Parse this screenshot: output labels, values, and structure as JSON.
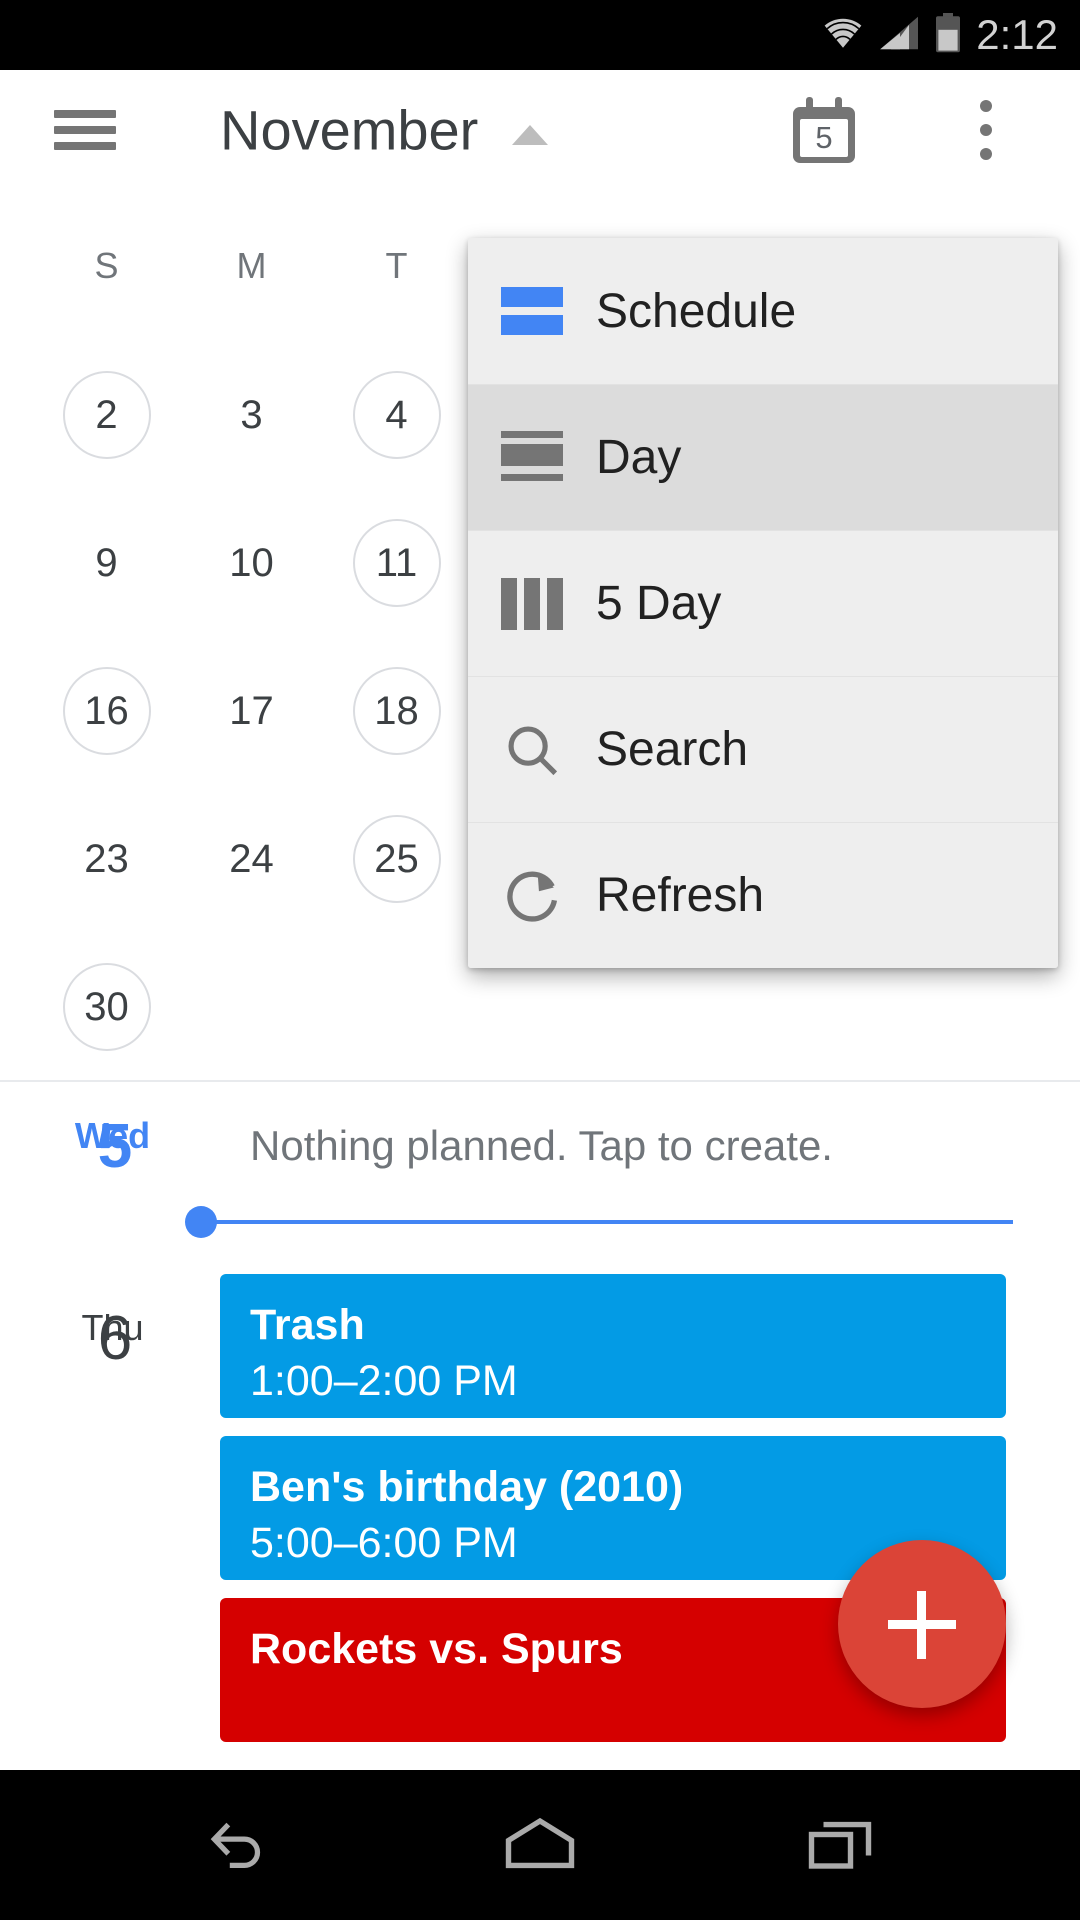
{
  "status_bar": {
    "time": "2:12",
    "icons": [
      "wifi-icon",
      "cellular-signal-icon",
      "battery-icon"
    ]
  },
  "app_bar": {
    "menu_icon": "hamburger-menu-icon",
    "title": "November",
    "caret_icon": "chevron-up-icon",
    "today_icon": "calendar-today-icon",
    "today_number": "5",
    "overflow_icon": "overflow-menu-icon"
  },
  "view_menu": {
    "items": [
      {
        "label": "Schedule",
        "icon": "schedule-view-icon",
        "selected": false,
        "active": true
      },
      {
        "label": "Day",
        "icon": "day-view-icon",
        "selected": true,
        "active": false
      },
      {
        "label": "5 Day",
        "icon": "five-day-view-icon",
        "selected": false,
        "active": false
      },
      {
        "label": "Search",
        "icon": "search-icon",
        "selected": false,
        "active": false
      },
      {
        "label": "Refresh",
        "icon": "refresh-icon",
        "selected": false,
        "active": false
      }
    ]
  },
  "mini_month": {
    "day_headers": [
      "S",
      "M",
      "T"
    ],
    "weeks": [
      [
        {
          "num": "2",
          "ring": true
        },
        {
          "num": "3",
          "ring": false
        },
        {
          "num": "4",
          "ring": true
        }
      ],
      [
        {
          "num": "9",
          "ring": false
        },
        {
          "num": "10",
          "ring": false
        },
        {
          "num": "11",
          "ring": true
        }
      ],
      [
        {
          "num": "16",
          "ring": true
        },
        {
          "num": "17",
          "ring": false
        },
        {
          "num": "18",
          "ring": true
        }
      ],
      [
        {
          "num": "23",
          "ring": false
        },
        {
          "num": "24",
          "ring": false
        },
        {
          "num": "25",
          "ring": true
        }
      ],
      [
        {
          "num": "30",
          "ring": true
        }
      ]
    ]
  },
  "schedule": {
    "days": [
      {
        "date_number": "5",
        "day_name": "Wed",
        "is_today": true,
        "empty_text": "Nothing planned. Tap to create.",
        "has_now_indicator": true,
        "events": []
      },
      {
        "date_number": "6",
        "day_name": "Thu",
        "is_today": false,
        "events": [
          {
            "title": "Trash",
            "time": "1:00–2:00 PM",
            "color": "#039be5"
          },
          {
            "title": "Ben's birthday (2010)",
            "time": "5:00–6:00 PM",
            "color": "#039be5"
          },
          {
            "title": "Rockets vs. Spurs",
            "time": "",
            "color": "#d50000"
          }
        ]
      }
    ]
  },
  "fab": {
    "label_icon": "plus-icon",
    "color": "#db4437"
  },
  "nav_bar": {
    "buttons": [
      {
        "icon": "back-icon"
      },
      {
        "icon": "home-icon"
      },
      {
        "icon": "recents-icon"
      }
    ]
  },
  "colors": {
    "accent_blue": "#4285f4",
    "event_blue": "#039be5",
    "event_red": "#d50000",
    "fab_red": "#db4437"
  }
}
